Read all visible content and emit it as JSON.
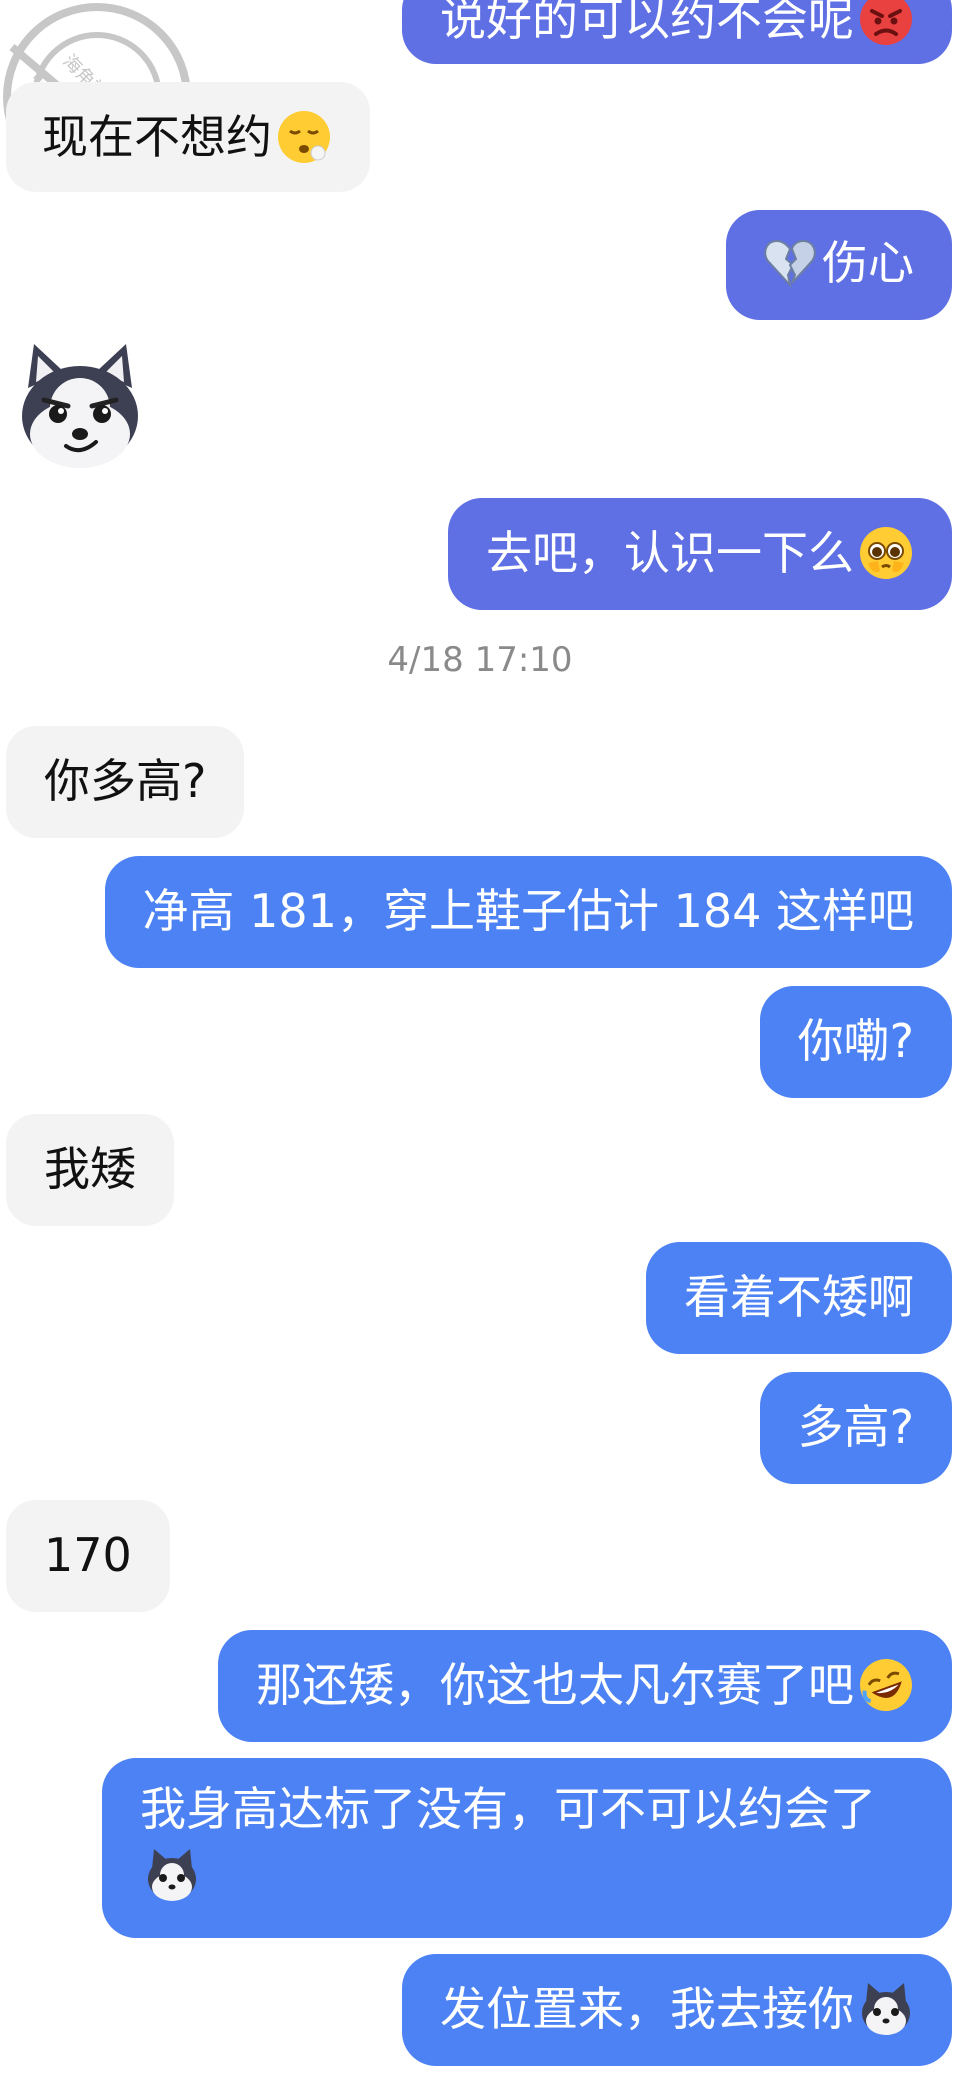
{
  "messages": [
    {
      "side": "right",
      "color": "purple",
      "text": "说好的可以约不会呢",
      "emoji_icon": "angry-face-icon"
    },
    {
      "side": "left",
      "text": "现在不想约",
      "emoji_icon": "tired-face-icon"
    },
    {
      "side": "right",
      "color": "purple",
      "text": "伤心",
      "prefix_emoji_icon": "broken-heart-icon"
    },
    {
      "side": "left",
      "sticker_icon": "husky-dog-sticker-icon"
    },
    {
      "side": "right",
      "color": "purple",
      "text": "去吧，认识一下么",
      "emoji_icon": "pleading-face-icon"
    },
    {
      "timestamp": "4/18 17:10"
    },
    {
      "side": "left",
      "text": "你多高?"
    },
    {
      "side": "right",
      "color": "blue",
      "text": "净高 181，穿上鞋子估计 184 这样吧"
    },
    {
      "side": "right",
      "color": "blue",
      "text": "你嘞?"
    },
    {
      "side": "left",
      "text": "我矮"
    },
    {
      "side": "right",
      "color": "blue",
      "text": "看着不矮啊"
    },
    {
      "side": "right",
      "color": "blue",
      "text": "多高?"
    },
    {
      "side": "left",
      "text": "170"
    },
    {
      "side": "right",
      "color": "blue",
      "text": "那还矮，你这也太凡尔赛了吧",
      "emoji_icon": "rofl-face-icon"
    },
    {
      "side": "right",
      "color": "blue",
      "text": "我身高达标了没有，可不可以约会了",
      "emoji_icon": "husky-dog-icon"
    },
    {
      "side": "right",
      "color": "blue",
      "text": "发位置来，我去接你",
      "emoji_icon": "husky-dog-icon"
    }
  ],
  "watermark": {
    "line1": "海角社区",
    "line2": "haijiao"
  },
  "colors": {
    "bubble_purple": "#5f6fe4",
    "bubble_blue": "#4c82f3",
    "bubble_gray": "#f3f3f3",
    "timestamp_gray": "#8a8a8a"
  }
}
